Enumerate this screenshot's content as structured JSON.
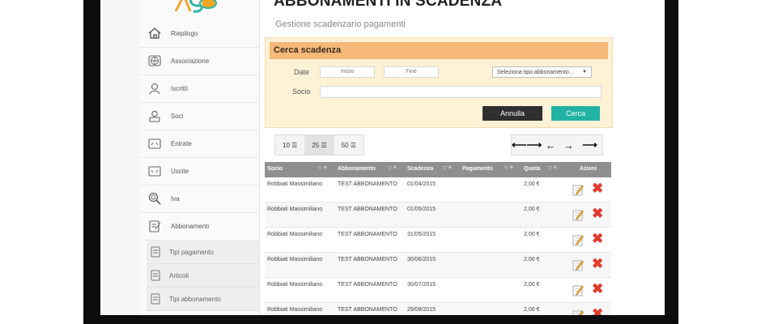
{
  "app": {
    "page_title": "ABBONAMENTI IN SCADENZA",
    "page_subtitle": "Gestione scadenzario pagamenti"
  },
  "nav": {
    "items": [
      {
        "label": "Riepilogo",
        "icon": "home-icon"
      },
      {
        "label": "Associazione",
        "icon": "globe-icon"
      },
      {
        "label": "Iscritti",
        "icon": "user-icon"
      },
      {
        "label": "Soci",
        "icon": "user-card-icon"
      },
      {
        "label": "Entrate",
        "icon": "income-icon"
      },
      {
        "label": "Uscite",
        "icon": "expense-icon"
      },
      {
        "label": "Iva",
        "icon": "magnifier-icon"
      },
      {
        "label": "Abbonamenti",
        "icon": "subscription-icon"
      }
    ],
    "sub_items": [
      {
        "label": "Tipi pagamento"
      },
      {
        "label": "Articoli"
      },
      {
        "label": "Tipi abbonamento"
      }
    ]
  },
  "search": {
    "title": "Cerca scadenza",
    "date_label": "Date",
    "start_placeholder": "Inizio",
    "end_placeholder": "Fine",
    "type_select": "Seleziona tipo abbonamento...",
    "member_label": "Socio",
    "cancel_label": "Annulla",
    "search_label": "Cerca"
  },
  "pager": {
    "sizes": [
      "10",
      "25",
      "50"
    ],
    "active_size": "25"
  },
  "table": {
    "columns": [
      "Socio",
      "Abbonamento",
      "Scadenza",
      "Pagamento",
      "Quota",
      "Azioni"
    ],
    "rows": [
      {
        "socio": "Robbiati Massimiliano",
        "abbonamento": "TEST ABBONAMENTO",
        "scadenza": "01/04/2015",
        "pagamento": "",
        "quota": "2,00 €"
      },
      {
        "socio": "Robbiati Massimiliano",
        "abbonamento": "TEST ABBONAMENTO",
        "scadenza": "01/05/2015",
        "pagamento": "",
        "quota": "2,00 €"
      },
      {
        "socio": "Robbiati Massimiliano",
        "abbonamento": "TEST ABBONAMENTO",
        "scadenza": "31/05/2015",
        "pagamento": "",
        "quota": "2,00 €"
      },
      {
        "socio": "Robbiati Massimiliano",
        "abbonamento": "TEST ABBONAMENTO",
        "scadenza": "30/06/2015",
        "pagamento": "",
        "quota": "2,00 €"
      },
      {
        "socio": "Robbiati Massimiliano",
        "abbonamento": "TEST ABBONAMENTO",
        "scadenza": "30/07/2015",
        "pagamento": "",
        "quota": "2,00 €"
      },
      {
        "socio": "Robbiati Massimiliano",
        "abbonamento": "TEST ABBONAMENTO",
        "scadenza": "29/08/2015",
        "pagamento": "",
        "quota": "2,00 €"
      }
    ]
  },
  "colors": {
    "search_header": "#f6b978",
    "search_bg": "#fdf1d6",
    "cancel_button": "#2f2f2f",
    "search_button": "#22b3a4",
    "table_header": "#8f8f8f",
    "delete_icon": "#e23b2e"
  }
}
